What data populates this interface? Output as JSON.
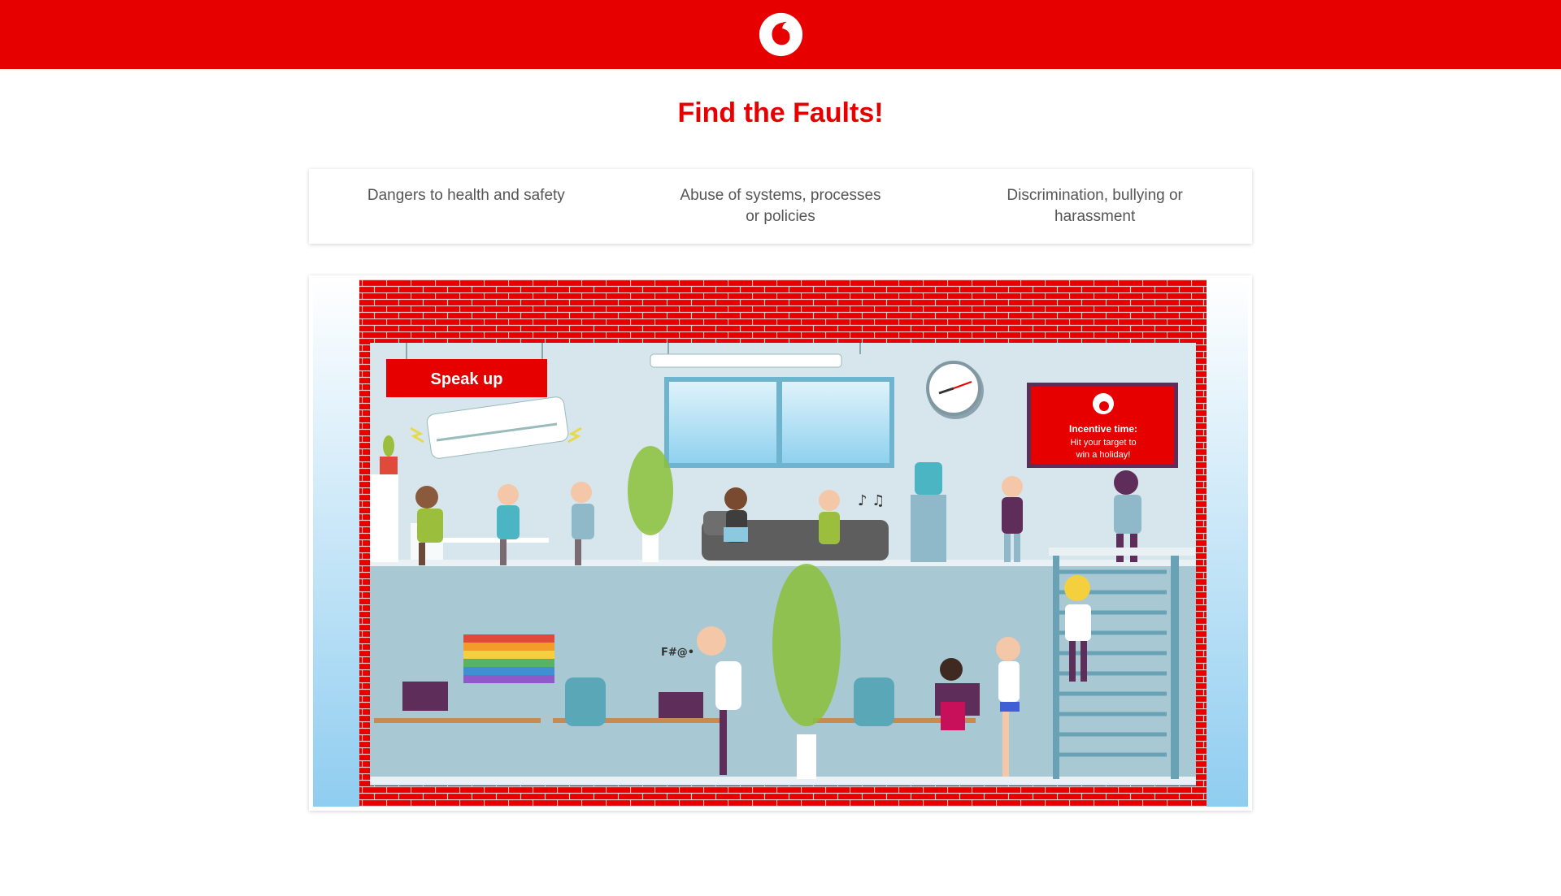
{
  "header": {
    "brand": "Vodafone",
    "logo_icon": "speechmark-logo-icon",
    "brand_color": "#e60000"
  },
  "page": {
    "title": "Find the Faults!"
  },
  "categories": [
    {
      "label": "Dangers to health and safety"
    },
    {
      "label": "Abuse of systems, processes or policies"
    },
    {
      "label": "Discrimination, bullying or harassment"
    }
  ],
  "scene": {
    "sign": "Speak up",
    "tv_title": "Incentive time:",
    "tv_line1": "Hit your target to",
    "tv_line2": "win a holiday!",
    "swear": "F#@•",
    "notes": "♪ ♫"
  }
}
